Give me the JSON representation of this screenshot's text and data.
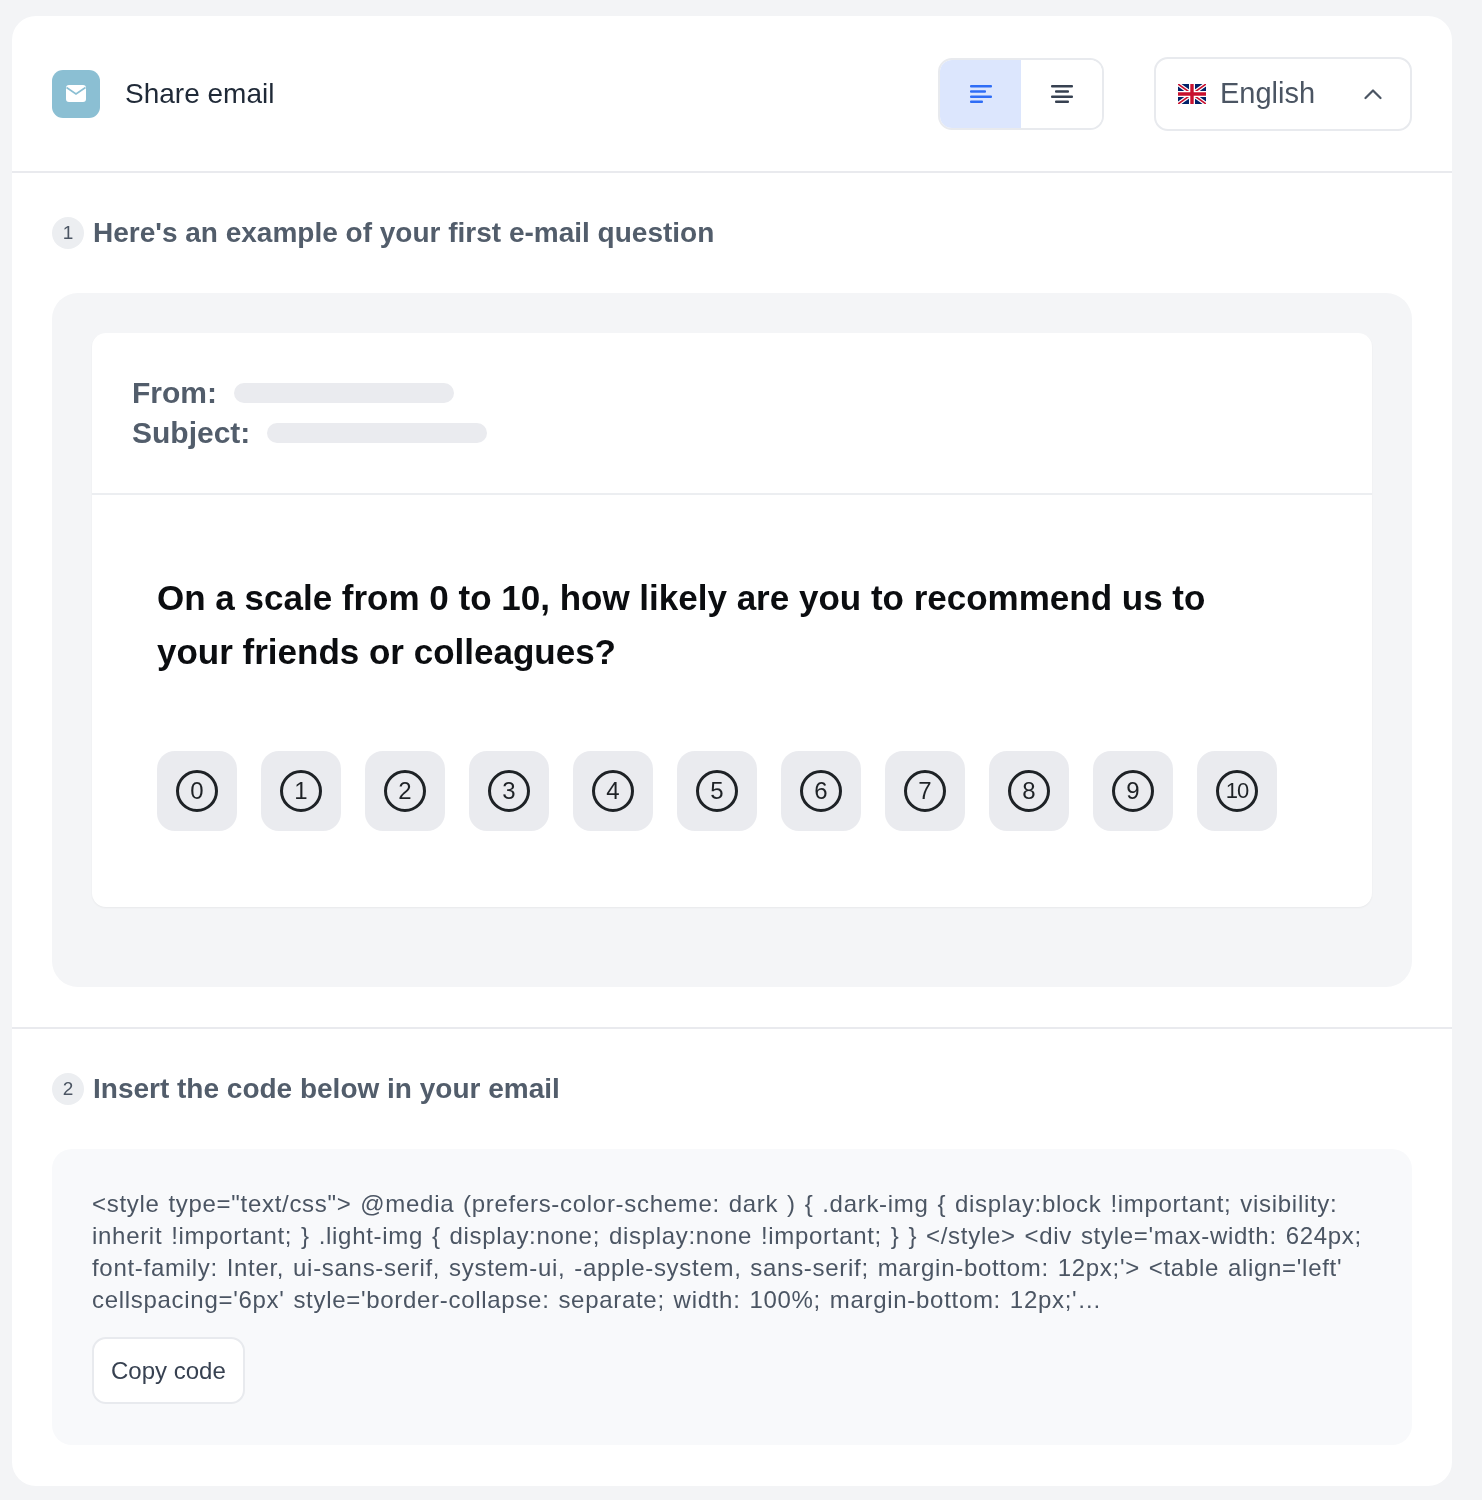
{
  "header": {
    "title": "Share email",
    "alignment_options": [
      {
        "kind": "left",
        "selected": true
      },
      {
        "kind": "center",
        "selected": false
      }
    ],
    "language": {
      "label": "English"
    }
  },
  "steps": [
    {
      "kind": "preview",
      "number": "1",
      "title": "Here's an example of your first e-mail question",
      "email": {
        "fields": [
          {
            "label": "From:"
          },
          {
            "label": "Subject:"
          }
        ],
        "question": "On a scale from 0 to 10, how likely are you to recommend us to your friends or colleagues?",
        "scale": [
          "0",
          "1",
          "2",
          "3",
          "4",
          "5",
          "6",
          "7",
          "8",
          "9",
          "10"
        ]
      }
    },
    {
      "kind": "code",
      "number": "2",
      "title": "Insert the code below in your email",
      "code": "<style type=\"text/css\"> @media (prefers-color-scheme: dark ) { .dark-img { display:block !important; visibility: inherit !important; } .light-img { display:none; display:none !important; } } </style> <div style='max-width: 624px; font-family: Inter, ui-sans-serif, system-ui, -apple-system, sans-serif; margin-bottom: 12px;'> <table align='left' cellspacing='6px' style='border-collapse: separate; width: 100%; margin-bottom: 12px;'…",
      "button": "Copy code"
    }
  ]
}
